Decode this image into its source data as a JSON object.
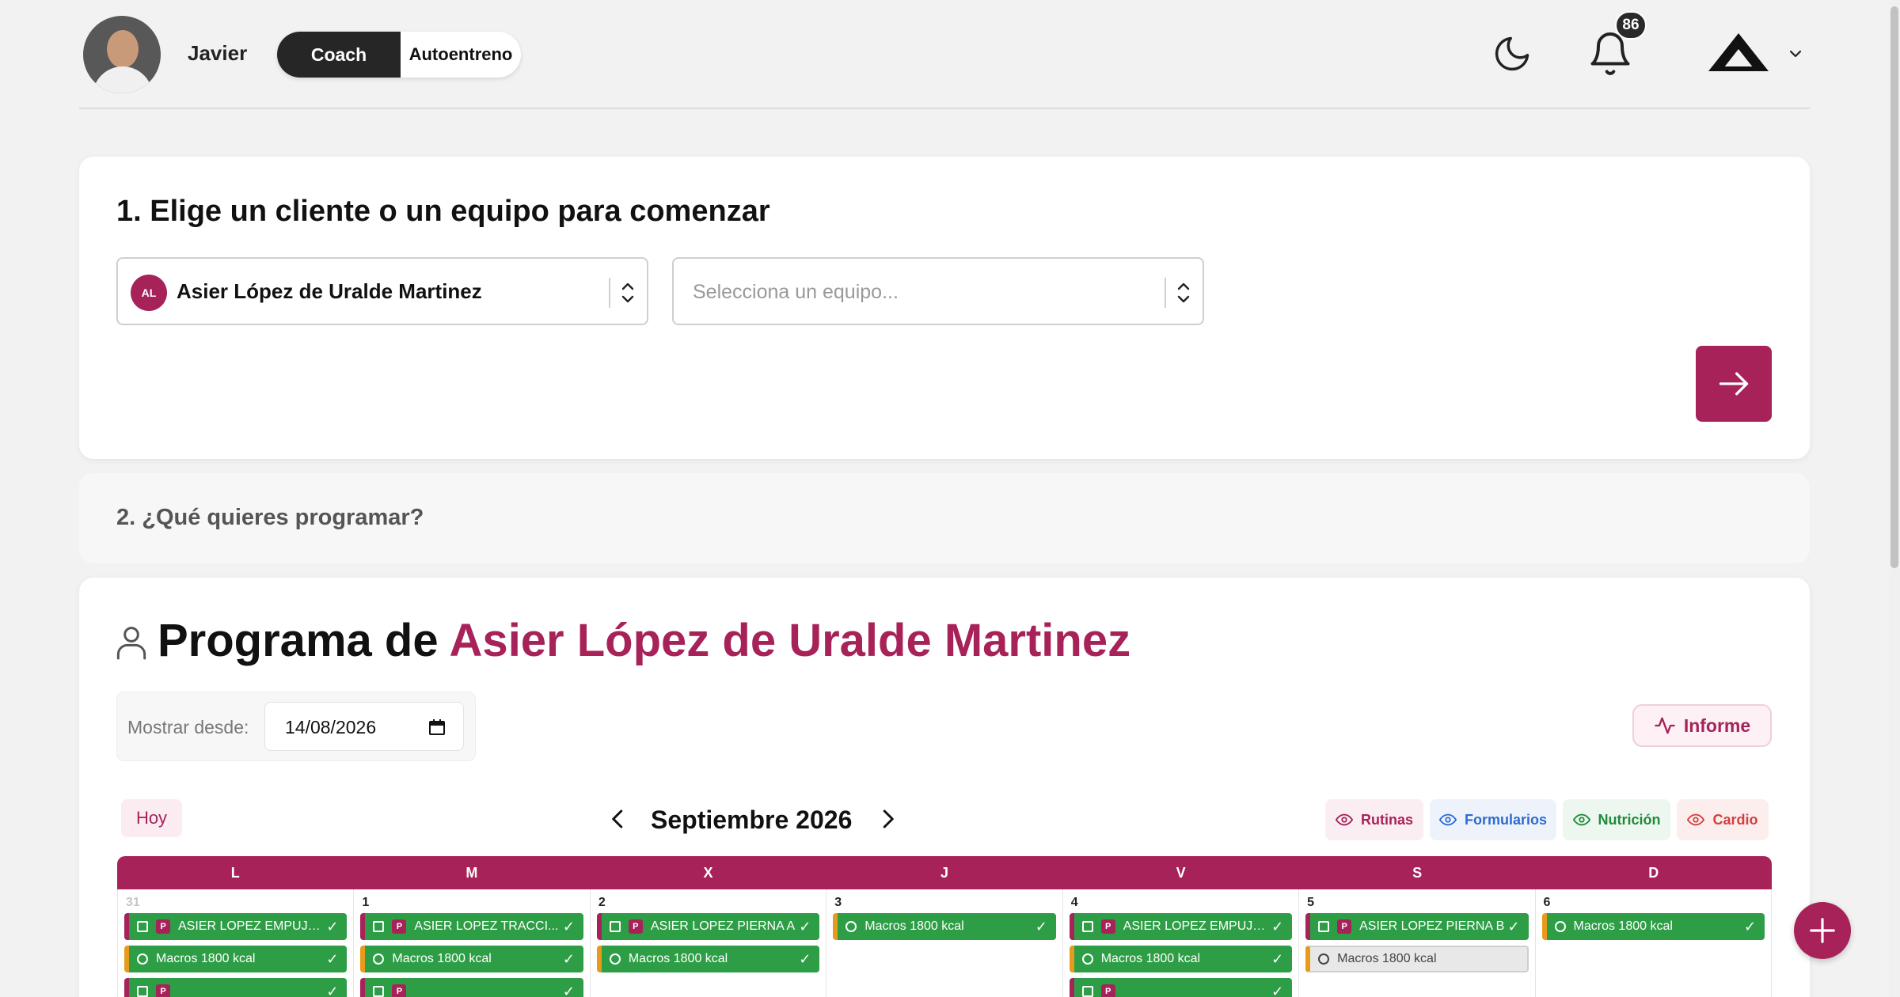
{
  "header": {
    "user_name": "Javier",
    "mode_coach": "Coach",
    "mode_auto": "Autoentreno",
    "notifications_count": "86"
  },
  "step1": {
    "title": "1. Elige un cliente o un equipo para comenzar",
    "client_initials": "AL",
    "client_name": "Asier López de Uralde Martinez",
    "team_placeholder": "Selecciona un equipo..."
  },
  "step2": {
    "title": "2. ¿Qué quieres programar?"
  },
  "program": {
    "title_prefix": "Programa de ",
    "client_name": "Asier López de Uralde Martinez",
    "date_label": "Mostrar desde:",
    "date_value": "14/08/2026",
    "informe_label": "Informe"
  },
  "calendar": {
    "today_label": "Hoy",
    "month": "Septiembre 2026",
    "filters": {
      "rutinas": "Rutinas",
      "formularios": "Formularios",
      "nutricion": "Nutrición",
      "cardio": "Cardio"
    },
    "weekdays": [
      "L",
      "M",
      "X",
      "J",
      "V",
      "S",
      "D"
    ],
    "days": [
      {
        "num": "31",
        "events": [
          {
            "kind": "rutina",
            "label": "ASIER LOPEZ EMPUJE..."
          },
          {
            "kind": "nutricion",
            "label": "Macros 1800 kcal"
          },
          {
            "kind": "rutina",
            "label": ""
          }
        ]
      },
      {
        "num": "1",
        "events": [
          {
            "kind": "rutina",
            "label": "ASIER LOPEZ TRACCI..."
          },
          {
            "kind": "nutricion",
            "label": "Macros 1800 kcal"
          },
          {
            "kind": "rutina",
            "label": ""
          }
        ]
      },
      {
        "num": "2",
        "events": [
          {
            "kind": "rutina",
            "label": "ASIER LOPEZ PIERNA A"
          },
          {
            "kind": "nutricion",
            "label": "Macros 1800 kcal"
          }
        ]
      },
      {
        "num": "3",
        "events": [
          {
            "kind": "nutricion",
            "label": "Macros 1800 kcal"
          }
        ]
      },
      {
        "num": "4",
        "events": [
          {
            "kind": "rutina",
            "label": "ASIER LOPEZ EMPUJE..."
          },
          {
            "kind": "nutricion",
            "label": "Macros 1800 kcal"
          },
          {
            "kind": "rutina",
            "label": ""
          }
        ]
      },
      {
        "num": "5",
        "events": [
          {
            "kind": "rutina",
            "label": "ASIER LOPEZ PIERNA B"
          },
          {
            "kind": "nutricion-pending",
            "label": "Macros 1800 kcal"
          }
        ]
      },
      {
        "num": "6",
        "events": [
          {
            "kind": "nutricion",
            "label": "Macros 1800 kcal"
          }
        ]
      }
    ]
  },
  "colors": {
    "brand": "#a72259",
    "event_green": "#2e9e46",
    "nutrition_accent": "#e89a1c"
  }
}
